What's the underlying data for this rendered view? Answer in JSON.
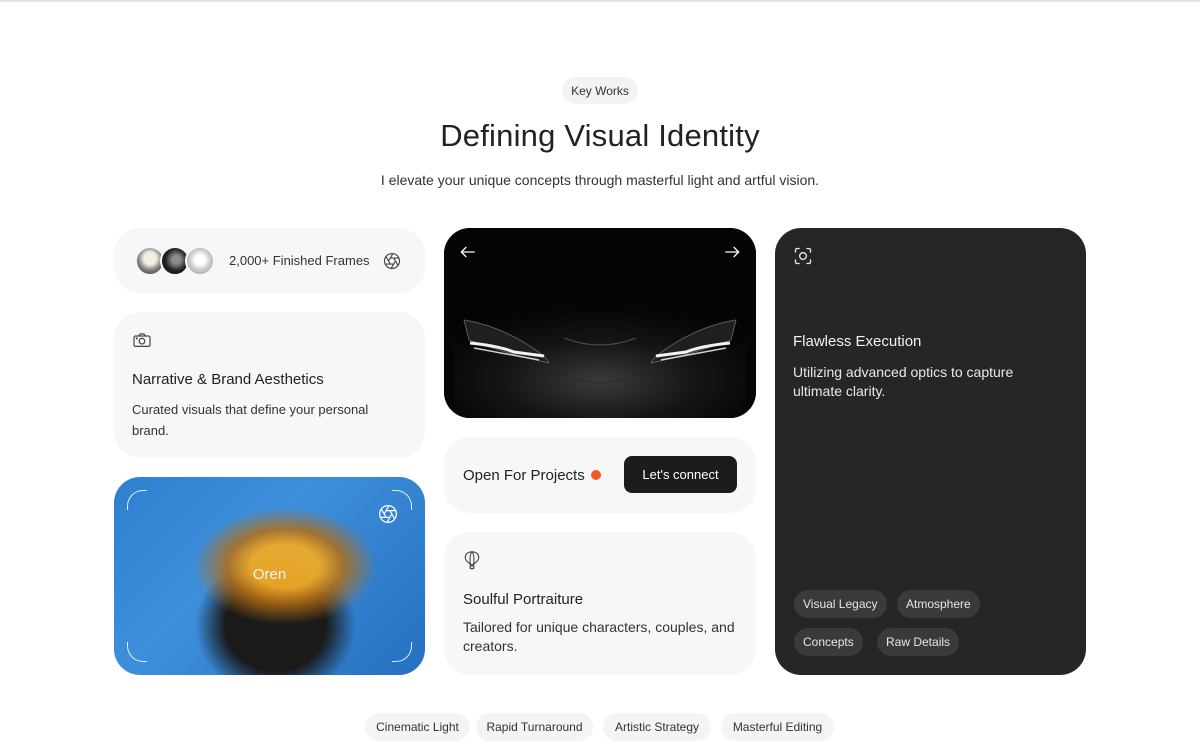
{
  "header": {
    "badge": "Key Works",
    "title": "Defining Visual Identity",
    "subtitle": "I elevate your unique concepts through masterful light and artful vision."
  },
  "frames": {
    "text": "2,000+ Finished Frames"
  },
  "narrative": {
    "icon": "camera-icon",
    "title": "Narrative & Brand Aesthetics",
    "description": "Curated visuals that define your personal brand."
  },
  "portrait": {
    "caption": "Oren"
  },
  "projects": {
    "label": "Open For Projects",
    "status_color": "#f05a28",
    "button": "Let's connect"
  },
  "soulful": {
    "icon": "hot-air-balloon-icon",
    "title": "Soulful Portraiture",
    "description": "Tailored for unique characters, couples, and creators."
  },
  "flawless": {
    "icon": "focus-icon",
    "title": "Flawless Execution",
    "description": "Utilizing advanced optics to capture ultimate clarity.",
    "tags": [
      "Visual Legacy",
      "Atmosphere",
      "Concepts",
      "Raw Details"
    ]
  },
  "bottom_tags": [
    "Cinematic Light",
    "Rapid Turnaround",
    "Artistic Strategy",
    "Masterful Editing"
  ]
}
